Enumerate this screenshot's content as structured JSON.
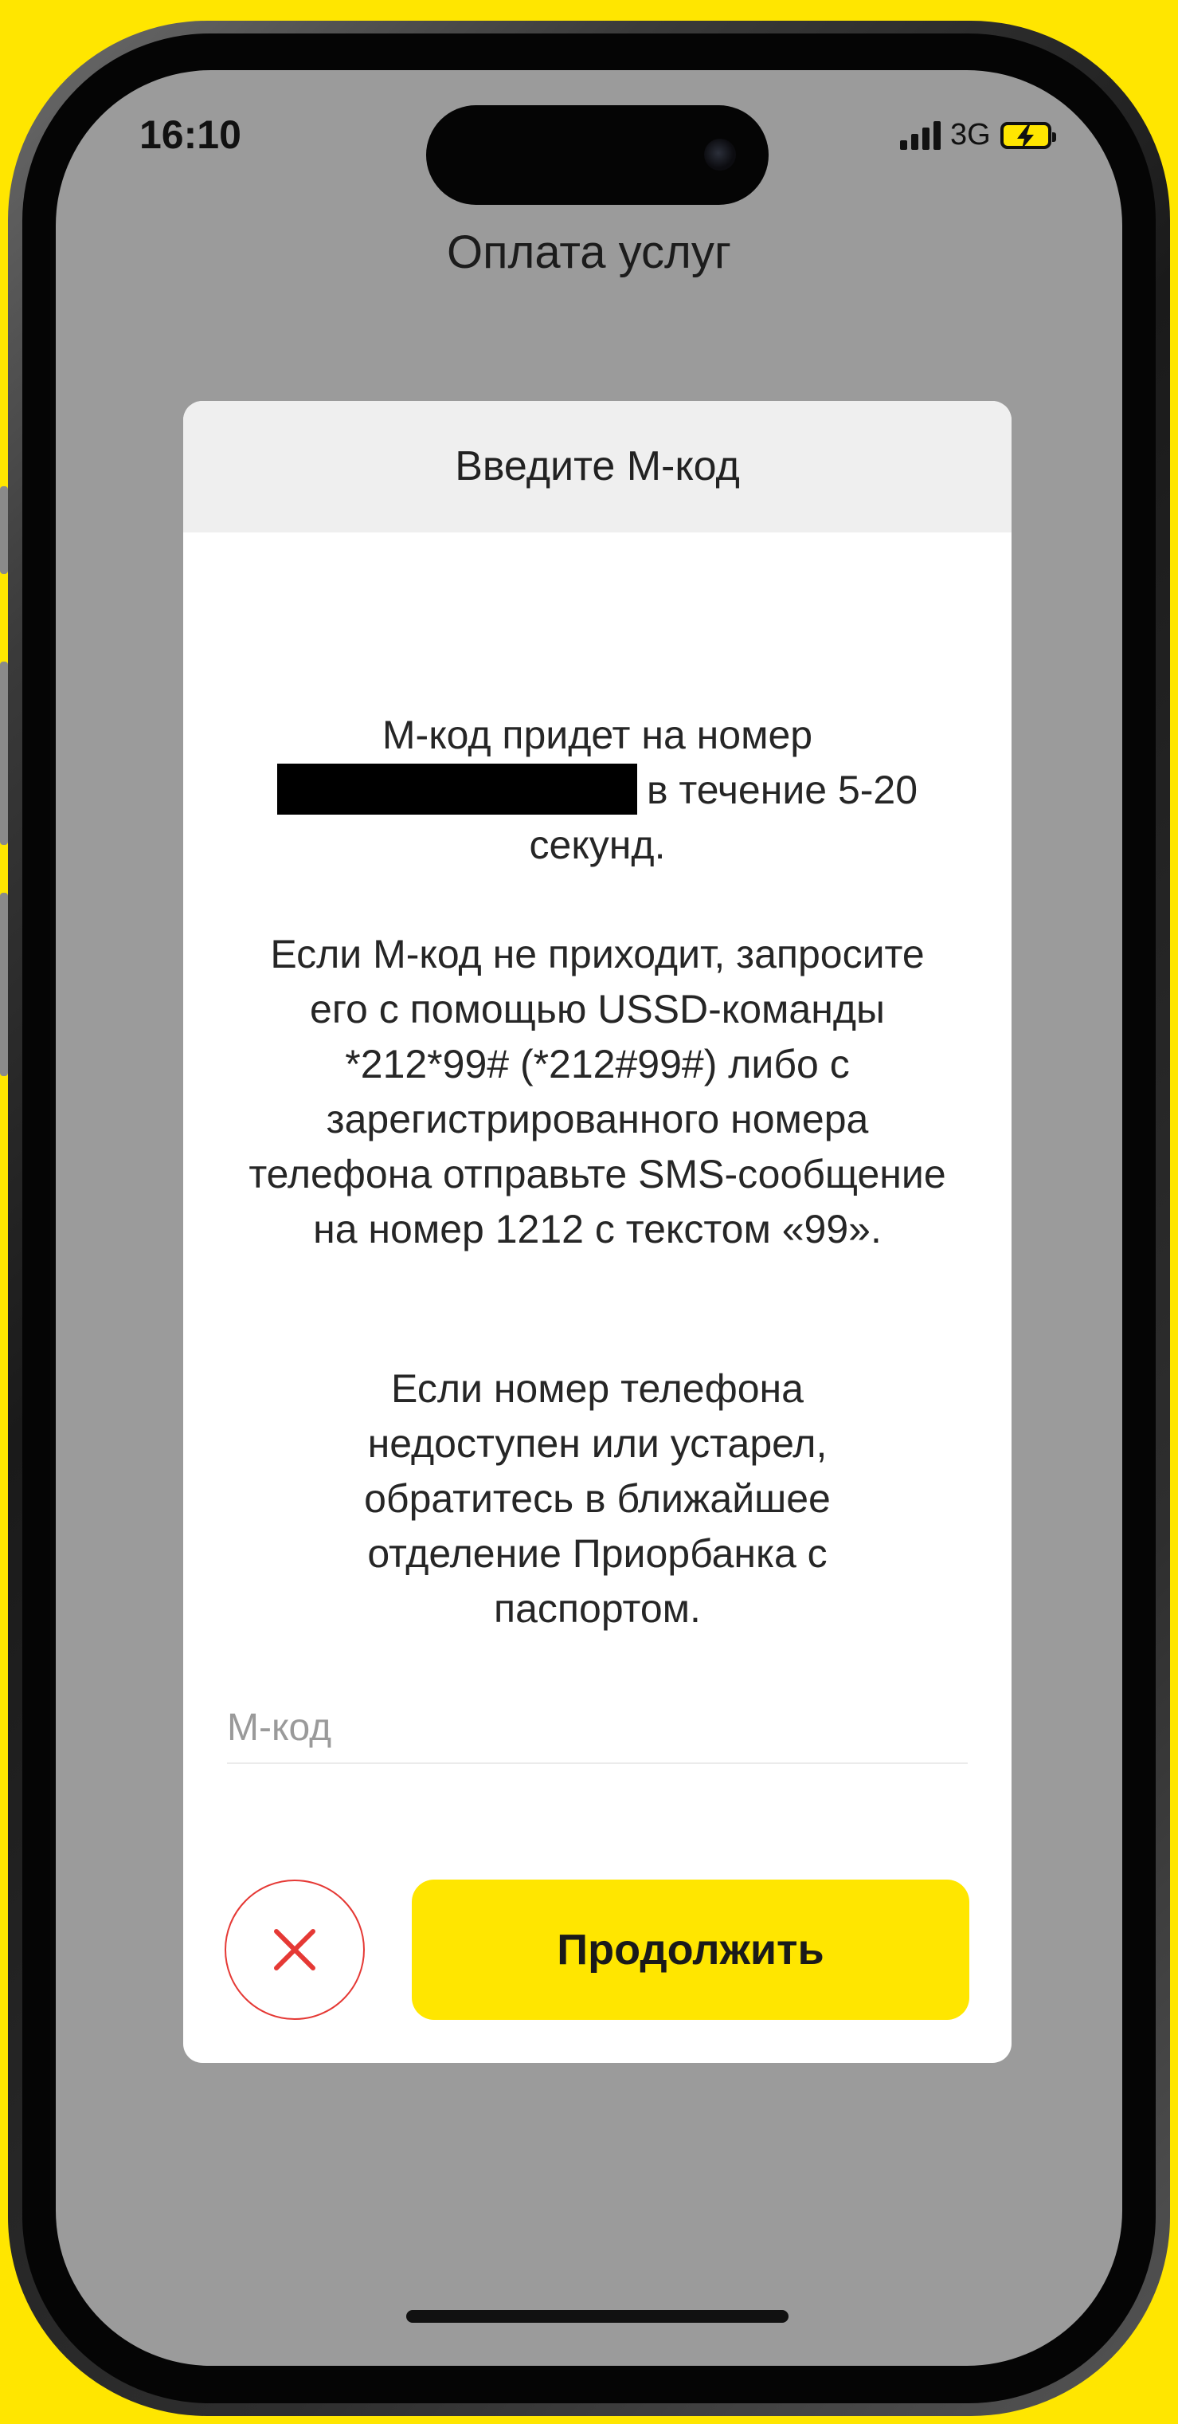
{
  "status_bar": {
    "time": "16:10",
    "network": "3G",
    "icons": [
      "signal-bars-icon",
      "battery-charging-icon"
    ]
  },
  "page": {
    "title": "Оплата услуг"
  },
  "dialog": {
    "title": "Введите М-код",
    "message_line1": "М-код придет на номер",
    "message_line2": "в течение 5-20",
    "message_line3": "секунд.",
    "paragraph2": "Если М-код не приходит, запросите его с помощью USSD-команды *212*99# (*212#99#) либо с зарегистрированного номера телефона отправьте SMS-сообщение на номер 1212 с текстом «99».",
    "paragraph3": "Если номер телефона недоступен или устарел, обратитесь в ближайшее отделение Приорбанка с паспортом.",
    "mcode": {
      "value": "",
      "placeholder": "М-код"
    },
    "cancel_icon": "close-icon",
    "continue_label": "Продолжить"
  },
  "colors": {
    "background": "#FFE600",
    "accent": "#FFE600",
    "cancel": "#E53935",
    "overlay": "#9B9B9B"
  }
}
